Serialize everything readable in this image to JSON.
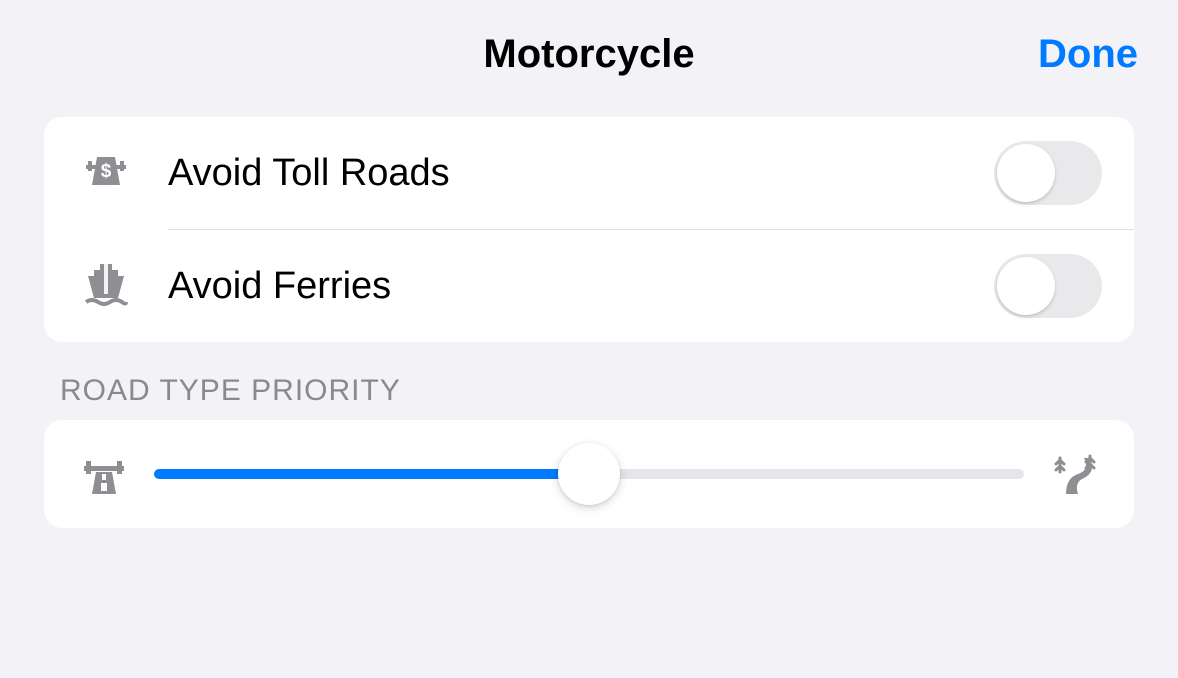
{
  "header": {
    "title": "Motorcycle",
    "done_label": "Done"
  },
  "avoid": {
    "toll": {
      "label": "Avoid Toll Roads",
      "enabled": false
    },
    "ferries": {
      "label": "Avoid Ferries",
      "enabled": false
    }
  },
  "roadType": {
    "section_label": "ROAD TYPE PRIORITY",
    "slider_value": 0.5
  }
}
